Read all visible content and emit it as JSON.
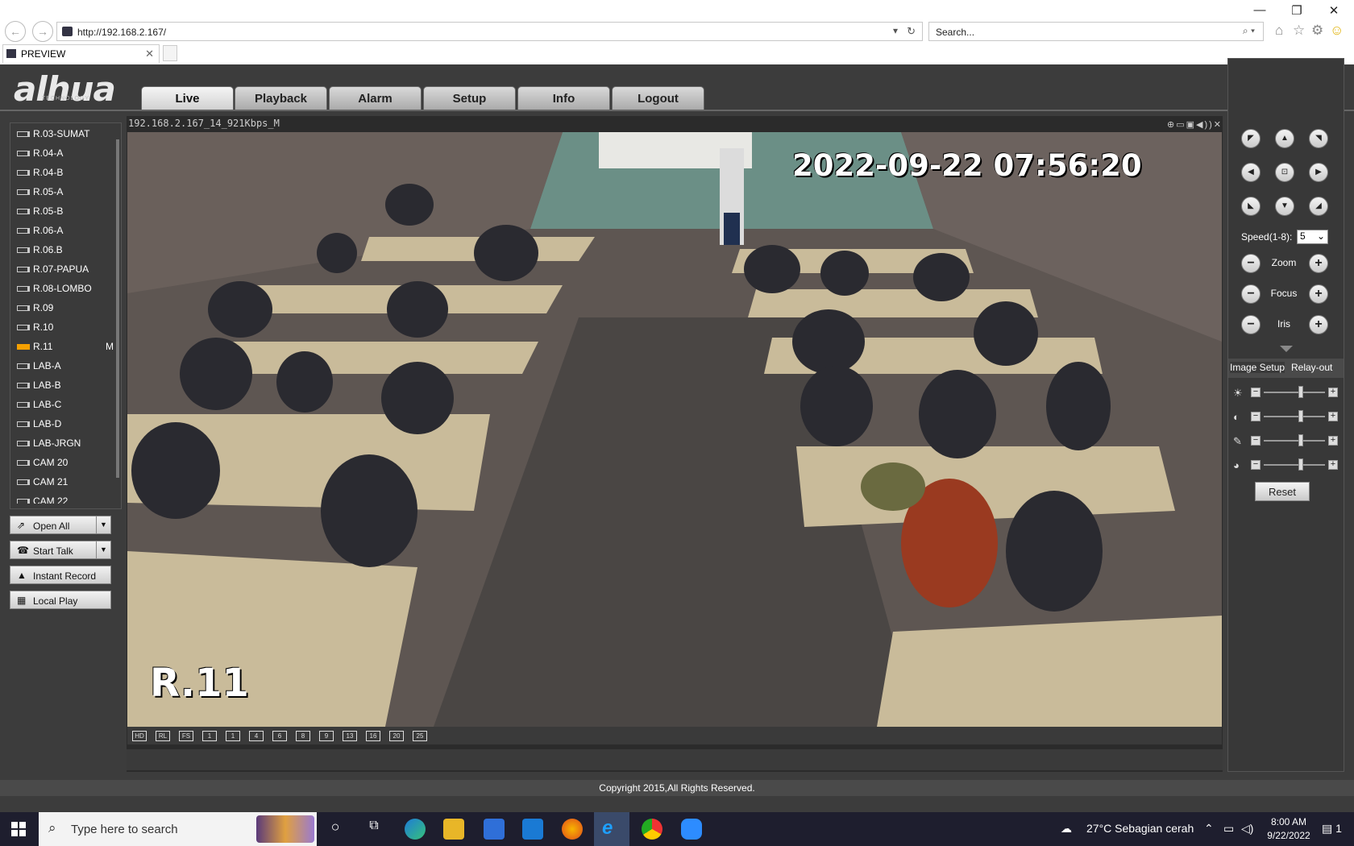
{
  "browser": {
    "url": "http://192.168.2.167/",
    "search_placeholder": "Search...",
    "tab_title": "PREVIEW"
  },
  "app": {
    "logo": "alhua",
    "logo_sub": "TECHNOLOGY",
    "menu": [
      "Live",
      "Playback",
      "Alarm",
      "Setup",
      "Info",
      "Logout"
    ],
    "active_menu": "Live"
  },
  "devices": [
    {
      "label": "R.03-SUMAT"
    },
    {
      "label": "R.04-A"
    },
    {
      "label": "R.04-B"
    },
    {
      "label": "R.05-A"
    },
    {
      "label": "R.05-B"
    },
    {
      "label": "R.06-A"
    },
    {
      "label": "R.06.B"
    },
    {
      "label": "R.07-PAPUA"
    },
    {
      "label": "R.08-LOMBO"
    },
    {
      "label": "R.09"
    },
    {
      "label": "R.10"
    },
    {
      "label": "R.11",
      "flag": "M",
      "active": true
    },
    {
      "label": "LAB-A"
    },
    {
      "label": "LAB-B"
    },
    {
      "label": "LAB-C"
    },
    {
      "label": "LAB-D"
    },
    {
      "label": "LAB-JRGN"
    },
    {
      "label": "CAM 20"
    },
    {
      "label": "CAM 21"
    },
    {
      "label": "CAM 22"
    }
  ],
  "actions": {
    "open_all": "Open All",
    "start_talk": "Start Talk",
    "instant_record": "Instant Record",
    "local_play": "Local Play"
  },
  "video": {
    "stream_title": "192.168.2.167_14_921Kbps_M",
    "osd_timestamp": "2022-09-22  07:56:20",
    "osd_channel": "R.11"
  },
  "layout_buttons": [
    "HD",
    "RL",
    "FS",
    "1",
    "1",
    "4",
    "6",
    "8",
    "9",
    "13",
    "16",
    "20",
    "25"
  ],
  "ptz": {
    "speed_label": "Speed(1-8):",
    "speed_value": "5",
    "zoom": "Zoom",
    "focus": "Focus",
    "iris": "Iris"
  },
  "image_setup": {
    "tab_image": "Image Setup",
    "tab_relay": "Relay-out",
    "reset": "Reset",
    "sliders": [
      {
        "name": "brightness",
        "level": 0.6
      },
      {
        "name": "contrast",
        "level": 0.6
      },
      {
        "name": "saturation",
        "level": 0.6
      },
      {
        "name": "hue",
        "level": 0.6
      }
    ]
  },
  "footer": "Copyright 2015,All Rights Reserved.",
  "taskbar": {
    "search_placeholder": "Type here to search",
    "weather": "27°C  Sebagian cerah",
    "time": "8:00 AM",
    "date": "9/22/2022",
    "notifications": "1"
  }
}
